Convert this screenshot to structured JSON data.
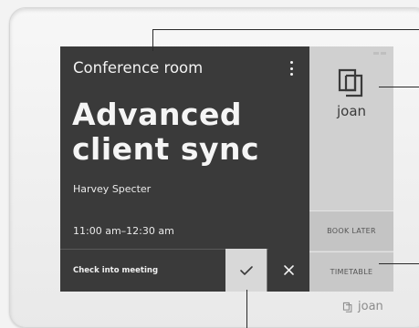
{
  "device": {
    "brand": "joan",
    "footer_brand": "joan"
  },
  "meeting": {
    "room": "Conference room",
    "title_line1": "Advanced",
    "title_line2": "client sync",
    "organizer": "Harvey Specter",
    "time": "11:00 am–12:30 am"
  },
  "checkin": {
    "label": "Check into meeting"
  },
  "side_buttons": {
    "book_later": "BOOK LATER",
    "timetable": "TIMETABLE"
  },
  "icons": {
    "menu": "more-vertical-icon",
    "confirm": "checkmark-icon",
    "decline": "close-icon",
    "logo": "joan-logo-icon",
    "status": "battery-wifi-status-icons"
  },
  "colors": {
    "screen_dark": "#3a3a3a",
    "side_panel": "#d0d0d0",
    "frame": "#f0f0f0",
    "text_light": "#f2f2f2",
    "text_dark": "#3a3a3a"
  }
}
